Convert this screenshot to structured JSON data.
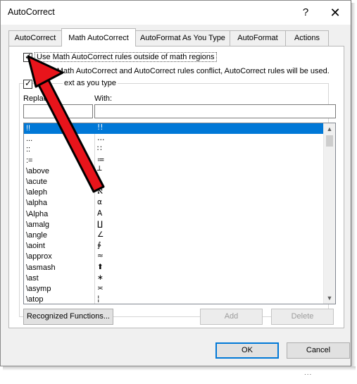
{
  "window": {
    "title": "AutoCorrect",
    "help": "?",
    "close": "✕"
  },
  "tabs": [
    {
      "label": "AutoCorrect",
      "active": false
    },
    {
      "label": "Math AutoCorrect",
      "active": true
    },
    {
      "label": "AutoFormat As You Type",
      "active": false
    },
    {
      "label": "AutoFormat",
      "active": false
    },
    {
      "label": "Actions",
      "active": false
    }
  ],
  "options": {
    "use_outside_math": {
      "label": "Use Math AutoCorrect rules outside of math regions",
      "checked": true
    },
    "conflict_note": "When Math AutoCorrect and AutoCorrect rules conflict, AutoCorrect rules will be used.",
    "replace_as_you_type": {
      "label": "Replace text as you type",
      "visible_label": "ext as you type",
      "checked": true
    }
  },
  "columns": {
    "replace": "Replace:",
    "with": "With:"
  },
  "inputs": {
    "replace_value": "",
    "with_value": ""
  },
  "list": [
    {
      "replace": "!!",
      "with": "!!",
      "selected": true
    },
    {
      "replace": "...",
      "with": "…"
    },
    {
      "replace": "::",
      "with": "∷"
    },
    {
      "replace": ":=",
      "with": "≔"
    },
    {
      "replace": "\\above",
      "with": "┴"
    },
    {
      "replace": "\\acute",
      "with": "́"
    },
    {
      "replace": "\\aleph",
      "with": "ℵ"
    },
    {
      "replace": "\\alpha",
      "with": "α"
    },
    {
      "replace": "\\Alpha",
      "with": "A"
    },
    {
      "replace": "\\amalg",
      "with": "∐"
    },
    {
      "replace": "\\angle",
      "with": "∠"
    },
    {
      "replace": "\\aoint",
      "with": "∳"
    },
    {
      "replace": "\\approx",
      "with": "≈"
    },
    {
      "replace": "\\asmash",
      "with": "⬆"
    },
    {
      "replace": "\\ast",
      "with": "∗"
    },
    {
      "replace": "\\asymp",
      "with": "≍"
    },
    {
      "replace": "\\atop",
      "with": "¦"
    }
  ],
  "buttons": {
    "recognized_functions": "Recognized Functions...",
    "add": "Add",
    "delete": "Delete",
    "ok": "OK",
    "cancel": "Cancel"
  },
  "scrollbar": {
    "up": "▲",
    "down": "▼"
  },
  "trailing_dots": "...",
  "colors": {
    "selection": "#0078d7",
    "annotation_arrow": "#e8141b",
    "dialog_bg": "#f0f0f0"
  },
  "icons": {
    "checkmark": "✓",
    "annotation": "red-arrow"
  }
}
